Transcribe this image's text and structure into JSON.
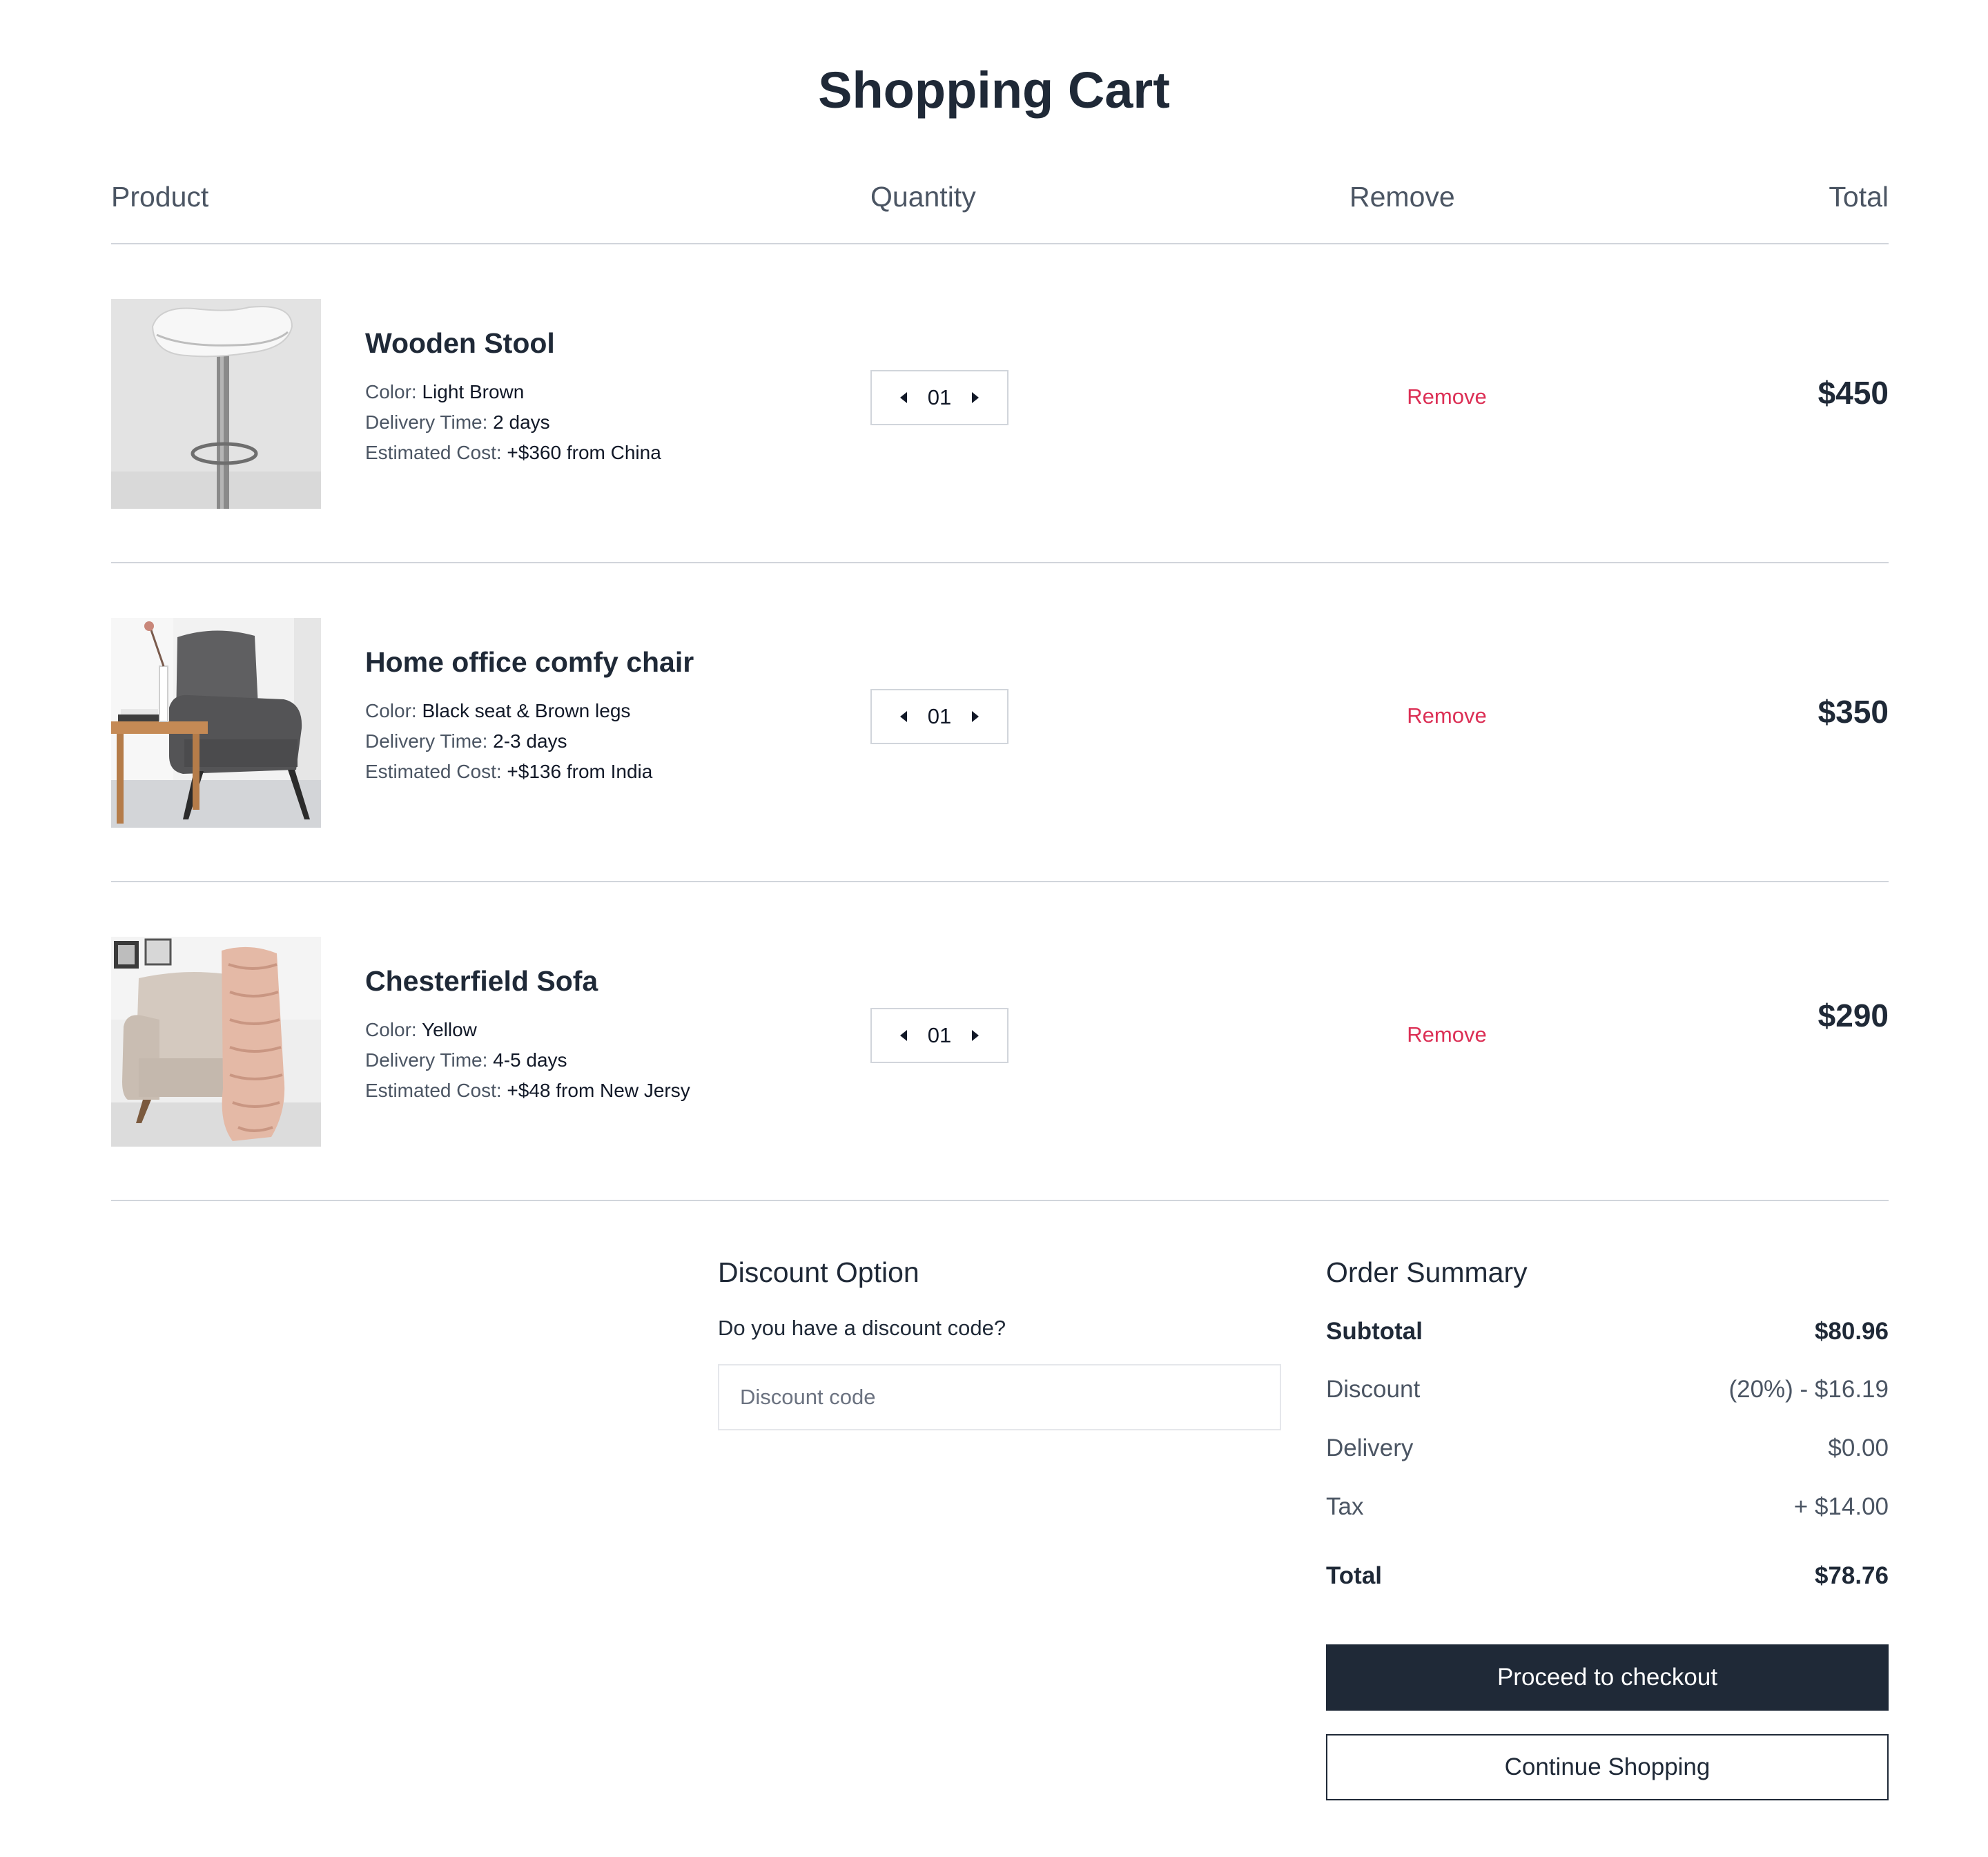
{
  "page": {
    "title": "Shopping Cart"
  },
  "columns": {
    "product": "Product",
    "quantity": "Quantity",
    "remove": "Remove",
    "total": "Total"
  },
  "items": [
    {
      "name": "Wooden Stool",
      "color_label": "Color:",
      "color": "Light Brown",
      "delivery_label": "Delivery Time:",
      "delivery": "2 days",
      "cost_label": "Estimated Cost:",
      "cost": "+$360 from China",
      "quantity": "01",
      "remove": "Remove",
      "price": "$450",
      "image": "stool-photo"
    },
    {
      "name": "Home office comfy chair",
      "color_label": "Color:",
      "color": "Black seat & Brown legs",
      "delivery_label": "Delivery Time:",
      "delivery": "2-3 days",
      "cost_label": "Estimated Cost:",
      "cost": "+$136 from India",
      "quantity": "01",
      "remove": "Remove",
      "price": "$350",
      "image": "chair-photo"
    },
    {
      "name": "Chesterfield Sofa",
      "color_label": "Color:",
      "color": "Yellow",
      "delivery_label": "Delivery Time:",
      "delivery": "4-5 days",
      "cost_label": "Estimated Cost:",
      "cost": "+$48 from New Jersy",
      "quantity": "01",
      "remove": "Remove",
      "price": "$290",
      "image": "sofa-photo"
    }
  ],
  "discount": {
    "title": "Discount Option",
    "question": "Do you have a discount code?",
    "placeholder": "Discount code",
    "value": ""
  },
  "summary": {
    "title": "Order Summary",
    "subtotal_label": "Subtotal",
    "subtotal": "$80.96",
    "discount_label": "Discount",
    "discount": "(20%) - $16.19",
    "delivery_label": "Delivery",
    "delivery": "$0.00",
    "tax_label": "Tax",
    "tax": "+ $14.00",
    "total_label": "Total",
    "total": "$78.76"
  },
  "buttons": {
    "checkout": "Proceed to checkout",
    "continue": "Continue Shopping"
  },
  "colors": {
    "primary": "#1f2937",
    "remove": "#dc2f55",
    "divider": "#d1d5db",
    "muted": "#4b5563"
  },
  "icons": {
    "decrease": "caret-left-icon",
    "increase": "caret-right-icon"
  }
}
